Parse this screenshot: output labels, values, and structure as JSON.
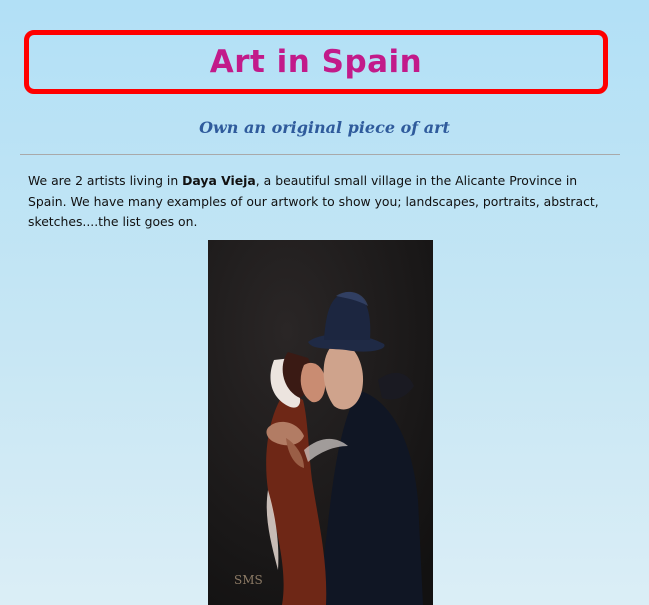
{
  "page": {
    "title": "Art in Spain",
    "subtitle": "Own an original piece of art",
    "intro": {
      "before": "We are 2 artists living in ",
      "highlight": "Daya Vieja",
      "after": ", a beautiful small village in the Alicante Province in Spain. We have many examples of our artwork to show you; landscapes, portraits, abstract, sketches....the list goes on."
    },
    "painting": {
      "signature": "SMS"
    }
  },
  "colors": {
    "title": "#c21a8a",
    "title_border": "#ff0000",
    "subtitle": "#2f5b9c"
  }
}
